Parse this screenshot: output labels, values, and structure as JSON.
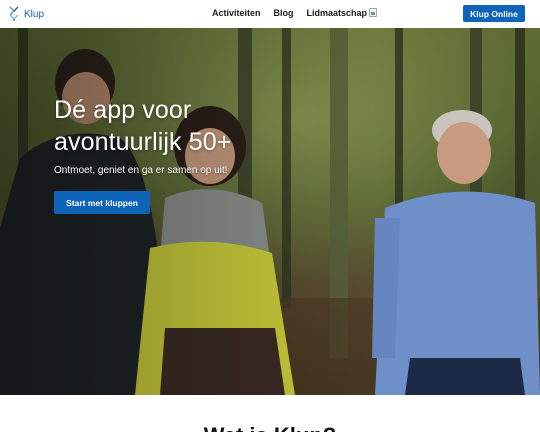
{
  "header": {
    "brand": {
      "name": "Klup",
      "icon": "klup-logo-icon",
      "color": "#1f5fa6"
    },
    "nav": [
      {
        "label": "Activiteiten"
      },
      {
        "label": "Blog"
      },
      {
        "label": "Lidmaatschap"
      }
    ],
    "broken_image_icon": "broken-image-icon",
    "cta_label": "Klup Online"
  },
  "hero": {
    "title": "Dé app voor avontuurlijk 50+",
    "subtitle": "Ontmoet, geniet en ga er samen op uit!",
    "button_label": "Start met kluppen",
    "photo": "photo-of-three-people-walking-in-forest"
  },
  "section": {
    "heading": "Wat is Klup?"
  },
  "colors": {
    "primary": "#0d64b8",
    "brand_text": "#1f5fa6",
    "nav_text": "#1d1d1d",
    "hero_text": "#ffffff"
  }
}
